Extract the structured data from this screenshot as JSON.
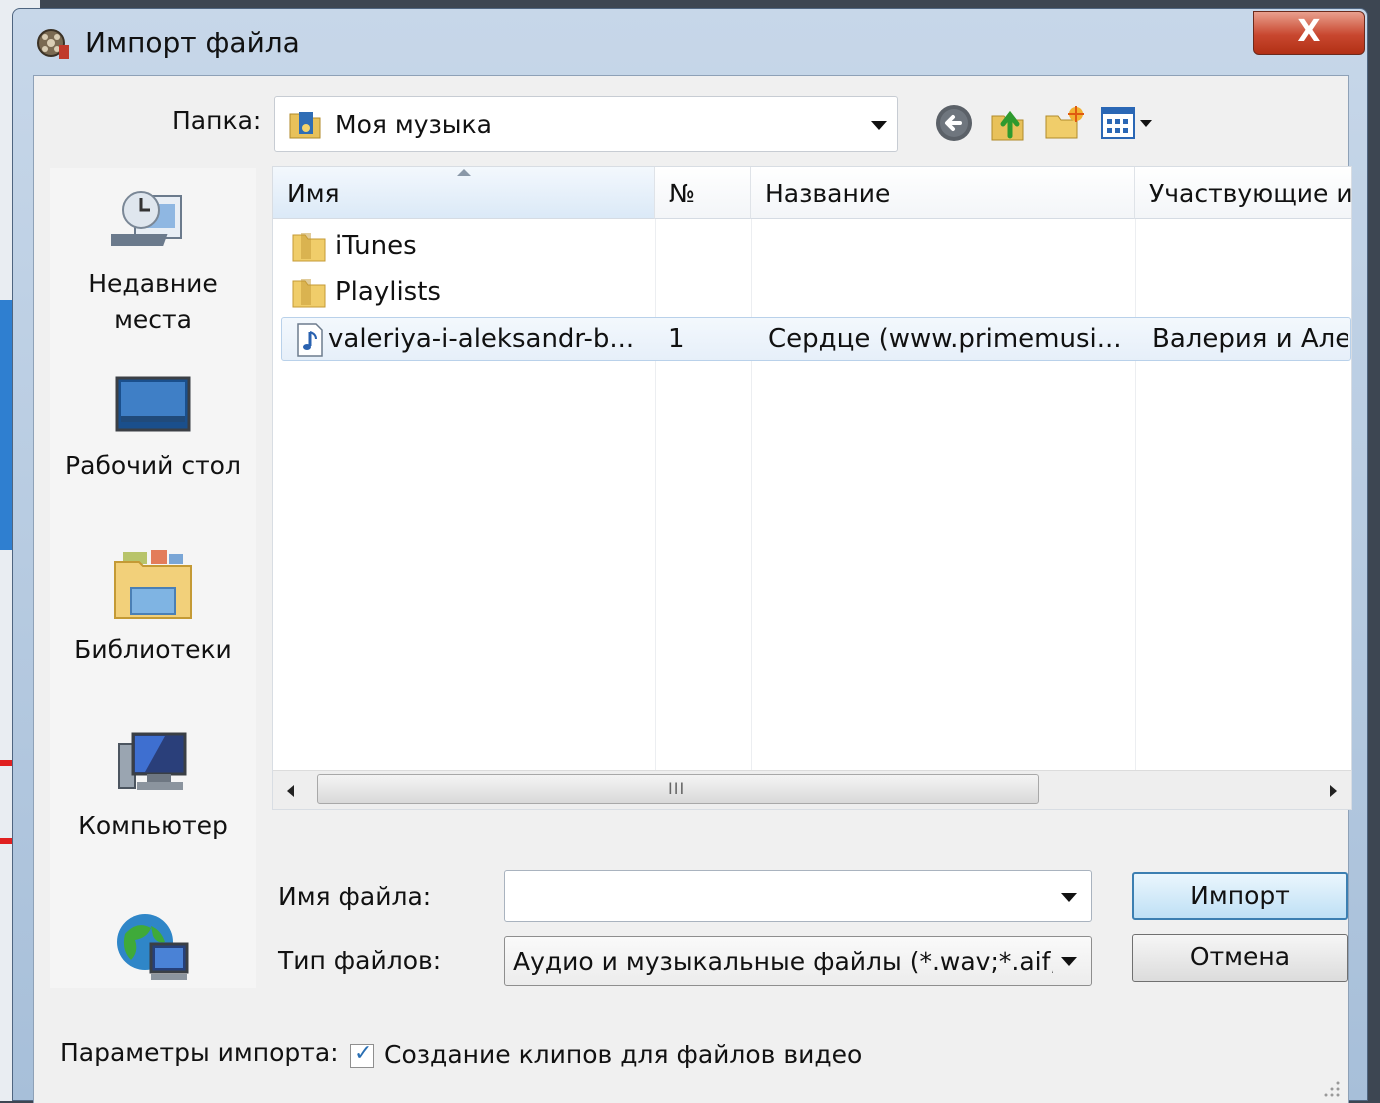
{
  "window": {
    "title": "Импорт файла",
    "close_label": "X"
  },
  "folder": {
    "label": "Папка:",
    "value": "Моя музыка"
  },
  "toolbar": {
    "icons": [
      "back-icon",
      "up-folder-icon",
      "new-folder-icon",
      "view-menu-icon"
    ]
  },
  "places": [
    {
      "label": "Недавние\nместа",
      "icon": "recent-places-icon"
    },
    {
      "label": "Рабочий стол",
      "icon": "desktop-icon"
    },
    {
      "label": "Библиотеки",
      "icon": "libraries-icon"
    },
    {
      "label": "Компьютер",
      "icon": "computer-icon"
    },
    {
      "label": "",
      "icon": "network-icon"
    }
  ],
  "columns": {
    "name": "Имя",
    "number": "№",
    "title": "Название",
    "artists": "Участвующие и"
  },
  "files": [
    {
      "name": "iTunes",
      "type": "folder",
      "number": "",
      "title": "",
      "artists": ""
    },
    {
      "name": "Playlists",
      "type": "folder",
      "number": "",
      "title": "",
      "artists": ""
    },
    {
      "name": "valeriya-i-aleksandr-b...",
      "type": "audio",
      "number": "1",
      "title": "Сердце (www.primemusi...",
      "artists": "Валерия и Алек"
    }
  ],
  "scrollbar": {
    "grip": "III"
  },
  "filename": {
    "label": "Имя файла:",
    "value": ""
  },
  "filetype": {
    "label": "Тип файлов:",
    "value": "Аудио и музыкальные файлы (*.wav;*.aif;*.ai"
  },
  "buttons": {
    "import": "Импорт",
    "cancel": "Отмена"
  },
  "options": {
    "label": "Параметры импорта:",
    "checkbox_label": "Создание клипов для файлов видео",
    "checkbox_checked": "✓"
  }
}
